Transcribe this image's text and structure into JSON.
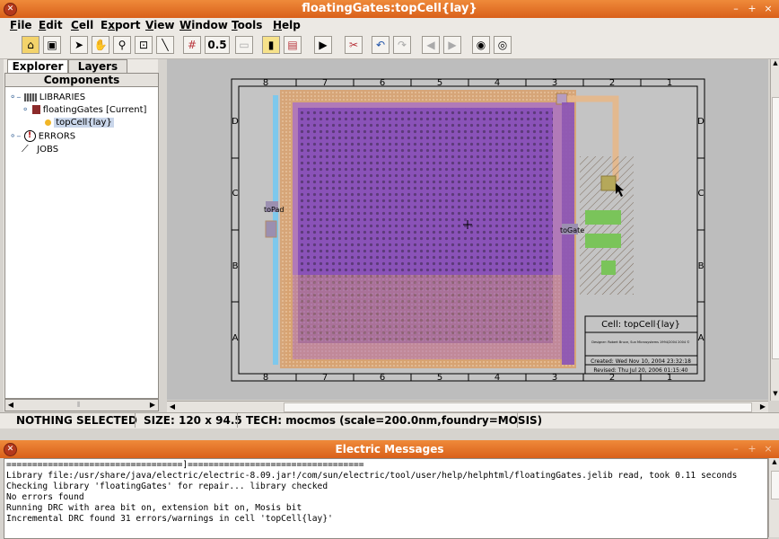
{
  "window": {
    "title": "floatingGates:topCell{lay}"
  },
  "menu": [
    {
      "pre": "",
      "u": "F",
      "post": "ile"
    },
    {
      "pre": "",
      "u": "E",
      "post": "dit"
    },
    {
      "pre": "",
      "u": "C",
      "post": "ell"
    },
    {
      "pre": "E",
      "u": "x",
      "post": "port"
    },
    {
      "pre": "",
      "u": "V",
      "post": "iew"
    },
    {
      "pre": "",
      "u": "W",
      "post": "indow"
    },
    {
      "pre": "",
      "u": "T",
      "post": "ools"
    },
    {
      "pre": "",
      "u": "H",
      "post": "elp"
    }
  ],
  "toolbar": {
    "scale_label": "0.5",
    "icons": [
      "open-library-icon",
      "save-icon",
      "select-arrow-icon",
      "pan-hand-icon",
      "zoom-icon",
      "zoom-fit-icon",
      "wire-tool-icon",
      "grid-icon",
      "scale-field",
      "full-grid-icon",
      "outline-edit-icon",
      "place-node-icon",
      "cursor-mode-icon",
      "tools-icon",
      "undo-icon",
      "redo-icon",
      "back-icon",
      "forward-icon",
      "show-eye-icon",
      "hide-eye-icon"
    ]
  },
  "explorer": {
    "tabs": [
      "Explorer",
      "Layers"
    ],
    "components_label": "Components",
    "tree": [
      {
        "label": "LIBRARIES",
        "icon": "libraries-icon"
      },
      {
        "label": "floatingGates [Current]",
        "icon": "library-icon"
      },
      {
        "label": "topCell{lay}",
        "icon": "cell-icon"
      },
      {
        "label": "ERRORS",
        "icon": "errors-icon"
      },
      {
        "label": "JOBS",
        "icon": "jobs-icon"
      }
    ]
  },
  "canvas": {
    "col_labels": [
      "8",
      "7",
      "6",
      "5",
      "4",
      "3",
      "2",
      "1"
    ],
    "row_labels": [
      "D",
      "C",
      "B",
      "A"
    ],
    "export_left": "toPad",
    "export_right": "toGate",
    "title_block": {
      "cell": "Cell: topCell{lay}",
      "designer": "Designer: Robert Bruce, Sun Microsystems 1994/2004 2004 ©",
      "created": "Created: Wed Nov 10, 2004 23:32:18",
      "revised": "Revised: Thu Jul 20, 2006 01:15:40"
    }
  },
  "status": {
    "selection": "NOTHING SELECTED",
    "size": "SIZE: 120 x 94.5",
    "tech": "TECH: mocmos (scale=200.0nm,foundry=MOSIS)"
  },
  "messages": {
    "title": "Electric Messages",
    "lines": [
      "==================================]==================================",
      "Library file:/usr/share/java/electric/electric-8.09.jar!/com/sun/electric/tool/user/help/helphtml/floatingGates.jelib read, took 0.11 seconds",
      "Checking library 'floatingGates' for repair... library checked",
      "No errors found",
      "Running DRC with area bit on, extension bit on, Mosis bit",
      "Incremental DRC found 31 errors/warnings in cell 'topCell{lay}'"
    ]
  }
}
